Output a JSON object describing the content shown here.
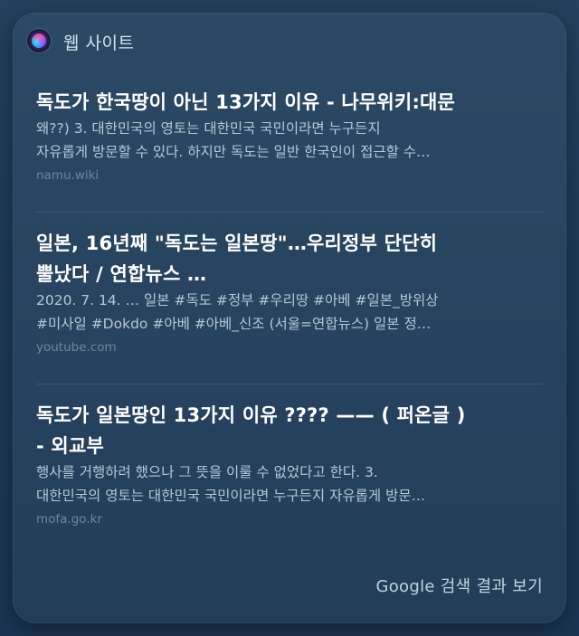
{
  "header": {
    "title": "웹 사이트"
  },
  "results": [
    {
      "title_line1": "독도가 한국땅이 아닌 13가지 이유 - 나무위키:대문",
      "title_line2": "",
      "snippet_line1": "왜??) 3. 대한민국의 영토는 대한민국 국민이라면 누구든지",
      "snippet_line2": "자유롭게 방문할 수 있다. 하지만 독도는 일반 한국인이 접근할 수…",
      "domain": "namu.wiki"
    },
    {
      "title_line1": "일본, 16년째 \"독도는 일본땅\"…우리정부 단단히",
      "title_line2": "뿔났다 / 연합뉴스 …",
      "snippet_line1": "2020. 7. 14. … 일본 #독도 #정부 #우리땅 #아베 #일본_방위상",
      "snippet_line2": "#미사일 #Dokdo #아베 #아베_신조 (서울=연합뉴스) 일본 정…",
      "domain": "youtube.com"
    },
    {
      "title_line1": "독도가 일본땅인 13가지 이유 ???? —— ( 퍼온글 )",
      "title_line2": "- 외교부",
      "snippet_line1": "행사를 거행하려 했으나 그 뜻을 이룰 수 없었다고 한다. 3.",
      "snippet_line2": "대한민국의 영토는 대한민국 국민이라면 누구든지 자유롭게 방문…",
      "domain": "mofa.go.kr"
    }
  ],
  "footer": {
    "link_label": "Google 검색 결과 보기"
  },
  "colors": {
    "panel_bg": "#284661",
    "title_text": "#ffffff",
    "snippet_text": "#b7c7d8",
    "domain_text": "#6f859c"
  },
  "icons": {
    "header_icon": "siri-icon"
  }
}
